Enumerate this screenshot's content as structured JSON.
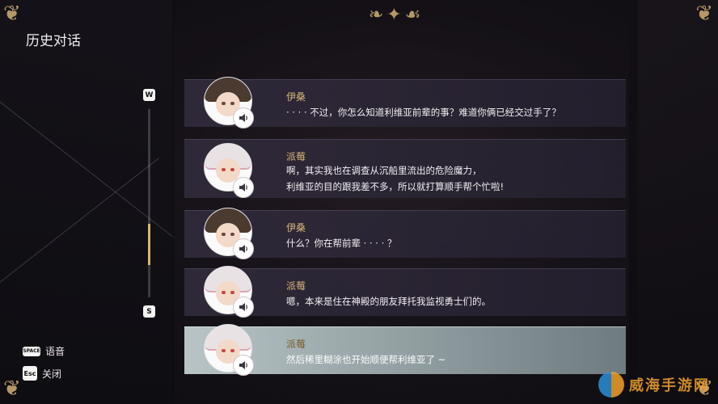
{
  "header": {
    "title": "历史对话"
  },
  "scrollbar": {
    "up_key": "W",
    "down_key": "S",
    "position_fraction": 0.78,
    "thumb_fraction": 0.22
  },
  "entries": [
    {
      "speaker": "伊桑",
      "lines": [
        "· · · · 不过，你怎么知道利维亚前辈的事？难道你俩已经交过手了？"
      ],
      "character": "brown-hair-boy",
      "active": false
    },
    {
      "speaker": "派莓",
      "lines": [
        "啊，其实我也在调查从沉船里流出的危险魔力，",
        "利维亚的目的跟我差不多，所以就打算顺手帮个忙啦!"
      ],
      "character": "white-hair-girl",
      "active": false
    },
    {
      "speaker": "伊桑",
      "lines": [
        "什么？你在帮前辈 · · · · ？"
      ],
      "character": "brown-hair-boy",
      "active": false
    },
    {
      "speaker": "派莓",
      "lines": [
        "嗯，本来是住在神殿的朋友拜托我监视勇士们的。"
      ],
      "character": "white-hair-girl",
      "active": false
    },
    {
      "speaker": "派莓",
      "lines": [
        "然后稀里糊涂也开始顺便帮利维亚了 ~"
      ],
      "character": "white-hair-girl",
      "active": true
    }
  ],
  "hints": {
    "voice": {
      "key": "SPACE",
      "label": "语音"
    },
    "close": {
      "key": "Esc",
      "label": "关闭"
    }
  },
  "watermark": {
    "text": "威海手游网"
  },
  "colors": {
    "accent_gold": "#d8b679",
    "ornament": "#b59866",
    "active_row": "#9eabad"
  },
  "icons": {
    "voice": "speaker-icon"
  }
}
